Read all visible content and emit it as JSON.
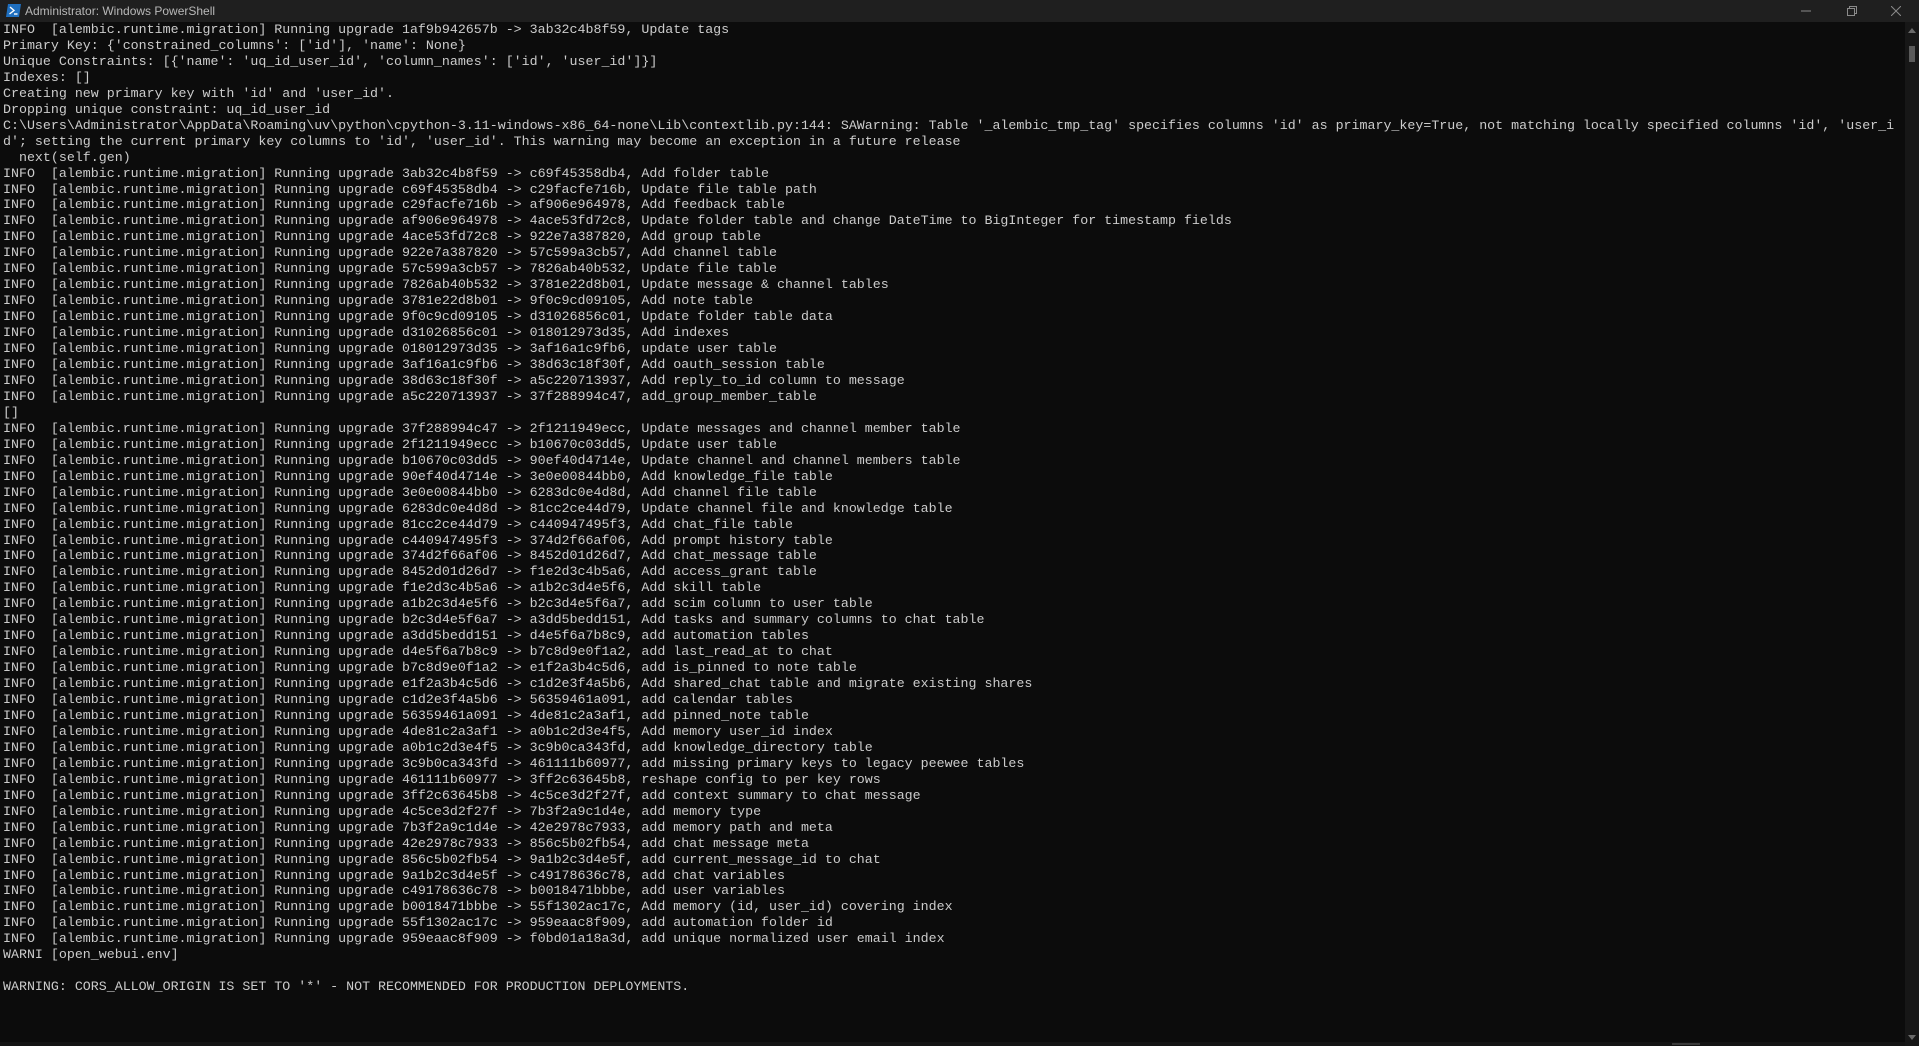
{
  "window": {
    "title": "Administrator: Windows PowerShell",
    "icon": "powershell-icon",
    "controls": [
      "minimize-icon",
      "maximize-icon",
      "close-icon"
    ]
  },
  "colors": {
    "background": "#0c0c0c",
    "text": "#cccccc",
    "titlebar": "#1f1f1f",
    "icon_blue": "#1f6fbf"
  },
  "console_lines": [
    "INFO  [alembic.runtime.migration] Running upgrade 1af9b942657b -> 3ab32c4b8f59, Update tags",
    "Primary Key: {'constrained_columns': ['id'], 'name': None}",
    "Unique Constraints: [{'name': 'uq_id_user_id', 'column_names': ['id', 'user_id']}]",
    "Indexes: []",
    "Creating new primary key with 'id' and 'user_id'.",
    "Dropping unique constraint: uq_id_user_id",
    "C:\\Users\\Administrator\\AppData\\Roaming\\uv\\python\\cpython-3.11-windows-x86_64-none\\Lib\\contextlib.py:144: SAWarning: Table '_alembic_tmp_tag' specifies columns 'id' as primary_key=True, not matching locally specified columns 'id', 'user_i",
    "d'; setting the current primary key columns to 'id', 'user_id'. This warning may become an exception in a future release",
    "  next(self.gen)",
    "INFO  [alembic.runtime.migration] Running upgrade 3ab32c4b8f59 -> c69f45358db4, Add folder table",
    "INFO  [alembic.runtime.migration] Running upgrade c69f45358db4 -> c29facfe716b, Update file table path",
    "INFO  [alembic.runtime.migration] Running upgrade c29facfe716b -> af906e964978, Add feedback table",
    "INFO  [alembic.runtime.migration] Running upgrade af906e964978 -> 4ace53fd72c8, Update folder table and change DateTime to BigInteger for timestamp fields",
    "INFO  [alembic.runtime.migration] Running upgrade 4ace53fd72c8 -> 922e7a387820, Add group table",
    "INFO  [alembic.runtime.migration] Running upgrade 922e7a387820 -> 57c599a3cb57, Add channel table",
    "INFO  [alembic.runtime.migration] Running upgrade 57c599a3cb57 -> 7826ab40b532, Update file table",
    "INFO  [alembic.runtime.migration] Running upgrade 7826ab40b532 -> 3781e22d8b01, Update message & channel tables",
    "INFO  [alembic.runtime.migration] Running upgrade 3781e22d8b01 -> 9f0c9cd09105, Add note table",
    "INFO  [alembic.runtime.migration] Running upgrade 9f0c9cd09105 -> d31026856c01, Update folder table data",
    "INFO  [alembic.runtime.migration] Running upgrade d31026856c01 -> 018012973d35, Add indexes",
    "INFO  [alembic.runtime.migration] Running upgrade 018012973d35 -> 3af16a1c9fb6, update user table",
    "INFO  [alembic.runtime.migration] Running upgrade 3af16a1c9fb6 -> 38d63c18f30f, Add oauth_session table",
    "INFO  [alembic.runtime.migration] Running upgrade 38d63c18f30f -> a5c220713937, Add reply_to_id column to message",
    "INFO  [alembic.runtime.migration] Running upgrade a5c220713937 -> 37f288994c47, add_group_member_table",
    "[]",
    "INFO  [alembic.runtime.migration] Running upgrade 37f288994c47 -> 2f1211949ecc, Update messages and channel member table",
    "INFO  [alembic.runtime.migration] Running upgrade 2f1211949ecc -> b10670c03dd5, Update user table",
    "INFO  [alembic.runtime.migration] Running upgrade b10670c03dd5 -> 90ef40d4714e, Update channel and channel members table",
    "INFO  [alembic.runtime.migration] Running upgrade 90ef40d4714e -> 3e0e00844bb0, Add knowledge_file table",
    "INFO  [alembic.runtime.migration] Running upgrade 3e0e00844bb0 -> 6283dc0e4d8d, Add channel file table",
    "INFO  [alembic.runtime.migration] Running upgrade 6283dc0e4d8d -> 81cc2ce44d79, Update channel file and knowledge table",
    "INFO  [alembic.runtime.migration] Running upgrade 81cc2ce44d79 -> c440947495f3, Add chat_file table",
    "INFO  [alembic.runtime.migration] Running upgrade c440947495f3 -> 374d2f66af06, Add prompt history table",
    "INFO  [alembic.runtime.migration] Running upgrade 374d2f66af06 -> 8452d01d26d7, Add chat_message table",
    "INFO  [alembic.runtime.migration] Running upgrade 8452d01d26d7 -> f1e2d3c4b5a6, Add access_grant table",
    "INFO  [alembic.runtime.migration] Running upgrade f1e2d3c4b5a6 -> a1b2c3d4e5f6, Add skill table",
    "INFO  [alembic.runtime.migration] Running upgrade a1b2c3d4e5f6 -> b2c3d4e5f6a7, add scim column to user table",
    "INFO  [alembic.runtime.migration] Running upgrade b2c3d4e5f6a7 -> a3dd5bedd151, Add tasks and summary columns to chat table",
    "INFO  [alembic.runtime.migration] Running upgrade a3dd5bedd151 -> d4e5f6a7b8c9, add automation tables",
    "INFO  [alembic.runtime.migration] Running upgrade d4e5f6a7b8c9 -> b7c8d9e0f1a2, add last_read_at to chat",
    "INFO  [alembic.runtime.migration] Running upgrade b7c8d9e0f1a2 -> e1f2a3b4c5d6, add is_pinned to note table",
    "INFO  [alembic.runtime.migration] Running upgrade e1f2a3b4c5d6 -> c1d2e3f4a5b6, Add shared_chat table and migrate existing shares",
    "INFO  [alembic.runtime.migration] Running upgrade c1d2e3f4a5b6 -> 56359461a091, add calendar tables",
    "INFO  [alembic.runtime.migration] Running upgrade 56359461a091 -> 4de81c2a3af1, add pinned_note table",
    "INFO  [alembic.runtime.migration] Running upgrade 4de81c2a3af1 -> a0b1c2d3e4f5, Add memory user_id index",
    "INFO  [alembic.runtime.migration] Running upgrade a0b1c2d3e4f5 -> 3c9b0ca343fd, add knowledge_directory table",
    "INFO  [alembic.runtime.migration] Running upgrade 3c9b0ca343fd -> 461111b60977, add missing primary keys to legacy peewee tables",
    "INFO  [alembic.runtime.migration] Running upgrade 461111b60977 -> 3ff2c63645b8, reshape config to per key rows",
    "INFO  [alembic.runtime.migration] Running upgrade 3ff2c63645b8 -> 4c5ce3d2f27f, add context summary to chat message",
    "INFO  [alembic.runtime.migration] Running upgrade 4c5ce3d2f27f -> 7b3f2a9c1d4e, add memory type",
    "INFO  [alembic.runtime.migration] Running upgrade 7b3f2a9c1d4e -> 42e2978c7933, add memory path and meta",
    "INFO  [alembic.runtime.migration] Running upgrade 42e2978c7933 -> 856c5b02fb54, add chat message meta",
    "INFO  [alembic.runtime.migration] Running upgrade 856c5b02fb54 -> 9a1b2c3d4e5f, add current_message_id to chat",
    "INFO  [alembic.runtime.migration] Running upgrade 9a1b2c3d4e5f -> c49178636c78, add chat variables",
    "INFO  [alembic.runtime.migration] Running upgrade c49178636c78 -> b0018471bbbe, add user variables",
    "INFO  [alembic.runtime.migration] Running upgrade b0018471bbbe -> 55f1302ac17c, Add memory (id, user_id) covering index",
    "INFO  [alembic.runtime.migration] Running upgrade 55f1302ac17c -> 959eaac8f909, add automation folder id",
    "INFO  [alembic.runtime.migration] Running upgrade 959eaac8f909 -> f0bd01a18a3d, add unique normalized user email index",
    "WARNI [open_webui.env]",
    "",
    "WARNING: CORS_ALLOW_ORIGIN IS SET TO '*' - NOT RECOMMENDED FOR PRODUCTION DEPLOYMENTS."
  ]
}
